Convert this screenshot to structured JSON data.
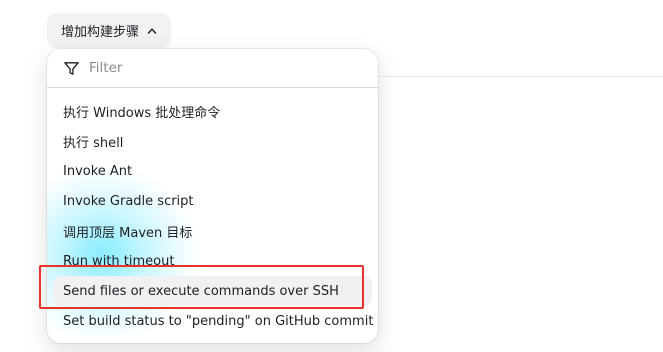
{
  "add_step_button": {
    "label": "增加构建步骤",
    "icon": "chevron-up-icon"
  },
  "filter": {
    "placeholder": "Filter",
    "value": "",
    "icon": "funnel-icon"
  },
  "menu_items": [
    {
      "label": "执行 Windows 批处理命令"
    },
    {
      "label": "执行 shell"
    },
    {
      "label": "Invoke Ant"
    },
    {
      "label": "Invoke Gradle script"
    },
    {
      "label": "调用顶层 Maven 目标"
    },
    {
      "label": "Run with timeout"
    },
    {
      "label": "Send files or execute commands over SSH",
      "hovered": true
    },
    {
      "label": "Set build status to \"pending\" on GitHub commit"
    }
  ],
  "annotation": {
    "color": "#e8332b"
  }
}
